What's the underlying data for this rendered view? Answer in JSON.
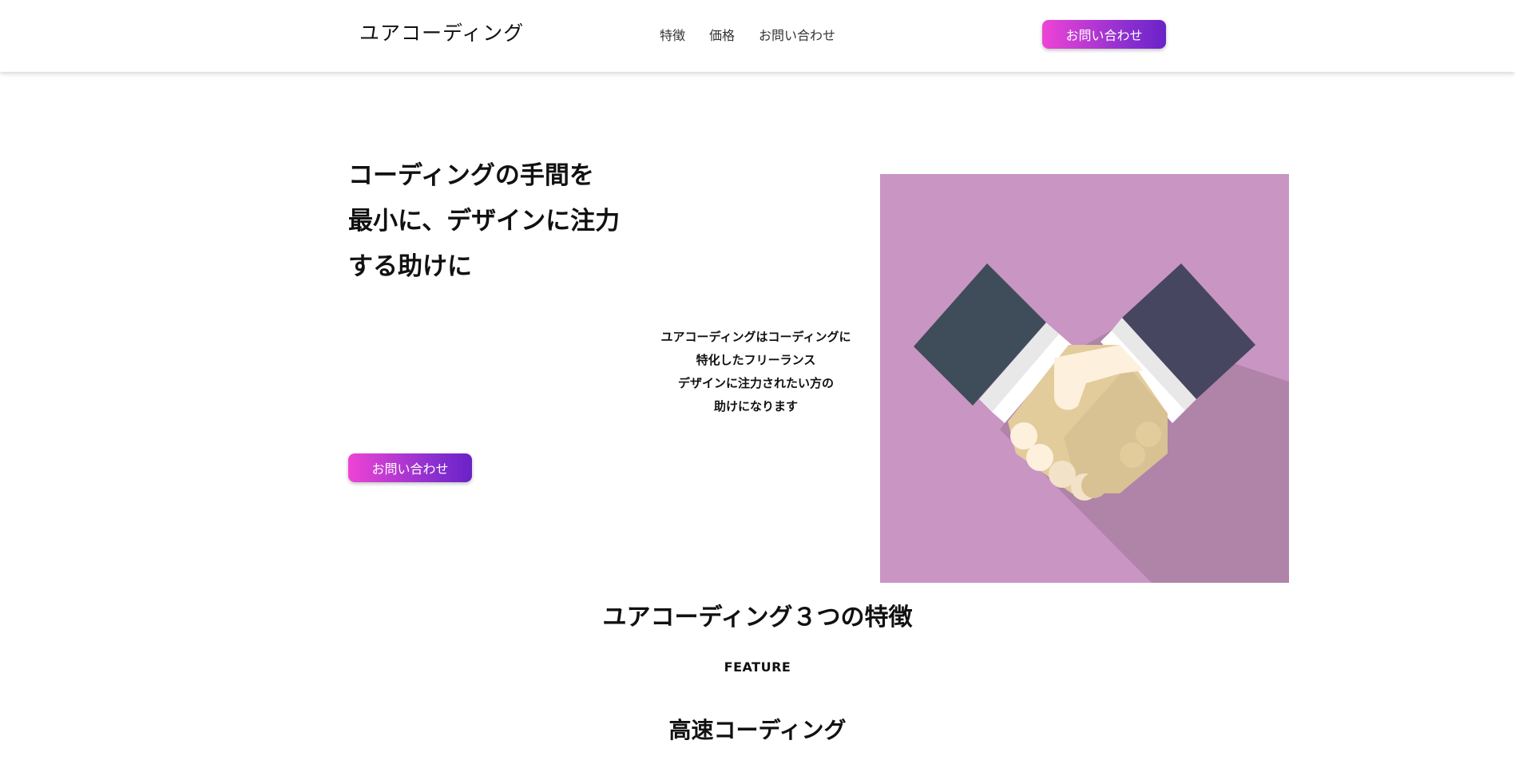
{
  "header": {
    "logo": "ユアコーディング",
    "nav": [
      "特徴",
      "価格",
      "お問い合わせ"
    ],
    "cta_label": "お問い合わせ"
  },
  "hero": {
    "title_lines": [
      "コーディングの手間を",
      "最小に、デザインに注力",
      "する助けに"
    ],
    "description_lines": [
      "ユアコーディングはコーディングに",
      "特化したフリーランス",
      "デザインに注力されたい方の",
      "助けになります"
    ],
    "cta_label": "お問い合わせ",
    "image_icon": "handshake-icon"
  },
  "features": {
    "title": "ユアコーディング３つの特徴",
    "subtitle": "FEATURE",
    "first_feature_title": "高速コーディング"
  },
  "colors": {
    "button_gradient_start": "#ee44d4",
    "button_gradient_end": "#6a22c7",
    "image_background": "#c995c3"
  }
}
